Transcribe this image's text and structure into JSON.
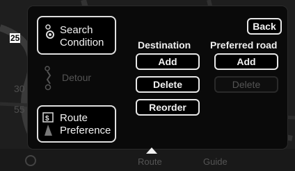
{
  "map": {
    "bg_labels": [
      "25",
      "30",
      "55"
    ],
    "bottom_labels": [
      "Route",
      "Guide"
    ]
  },
  "panel": {
    "search_condition": {
      "line1": "Search",
      "line2": "Condition"
    },
    "detour": {
      "label": "Detour"
    },
    "route_preference": {
      "line1": "Route",
      "line2": "Preference"
    },
    "back_label": "Back",
    "destination": {
      "heading": "Destination",
      "add": "Add",
      "delete": "Delete",
      "reorder": "Reorder"
    },
    "preferred_road": {
      "heading": "Preferred road",
      "add": "Add",
      "delete": "Delete"
    }
  },
  "colors": {
    "panel_bg": "#0a0a0a",
    "button_border": "#e8e8e8",
    "disabled_text": "#555555"
  }
}
